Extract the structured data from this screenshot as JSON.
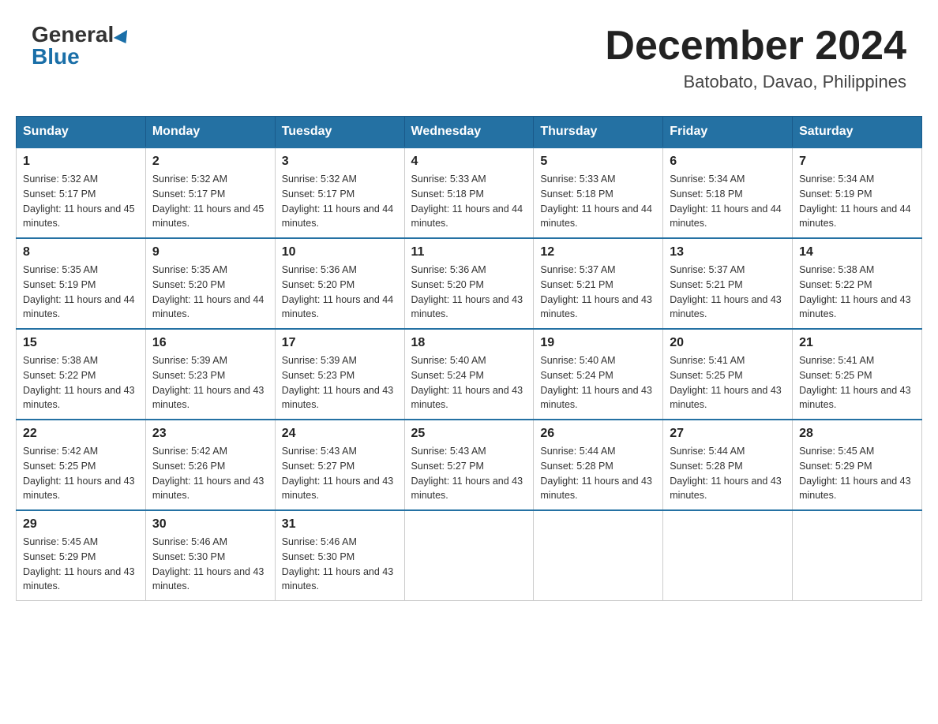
{
  "header": {
    "logo_general": "General",
    "logo_blue": "Blue",
    "month_title": "December 2024",
    "location": "Batobato, Davao, Philippines"
  },
  "days_of_week": [
    "Sunday",
    "Monday",
    "Tuesday",
    "Wednesday",
    "Thursday",
    "Friday",
    "Saturday"
  ],
  "weeks": [
    [
      {
        "day": "1",
        "sunrise": "5:32 AM",
        "sunset": "5:17 PM",
        "daylight": "11 hours and 45 minutes."
      },
      {
        "day": "2",
        "sunrise": "5:32 AM",
        "sunset": "5:17 PM",
        "daylight": "11 hours and 45 minutes."
      },
      {
        "day": "3",
        "sunrise": "5:32 AM",
        "sunset": "5:17 PM",
        "daylight": "11 hours and 44 minutes."
      },
      {
        "day": "4",
        "sunrise": "5:33 AM",
        "sunset": "5:18 PM",
        "daylight": "11 hours and 44 minutes."
      },
      {
        "day": "5",
        "sunrise": "5:33 AM",
        "sunset": "5:18 PM",
        "daylight": "11 hours and 44 minutes."
      },
      {
        "day": "6",
        "sunrise": "5:34 AM",
        "sunset": "5:18 PM",
        "daylight": "11 hours and 44 minutes."
      },
      {
        "day": "7",
        "sunrise": "5:34 AM",
        "sunset": "5:19 PM",
        "daylight": "11 hours and 44 minutes."
      }
    ],
    [
      {
        "day": "8",
        "sunrise": "5:35 AM",
        "sunset": "5:19 PM",
        "daylight": "11 hours and 44 minutes."
      },
      {
        "day": "9",
        "sunrise": "5:35 AM",
        "sunset": "5:20 PM",
        "daylight": "11 hours and 44 minutes."
      },
      {
        "day": "10",
        "sunrise": "5:36 AM",
        "sunset": "5:20 PM",
        "daylight": "11 hours and 44 minutes."
      },
      {
        "day": "11",
        "sunrise": "5:36 AM",
        "sunset": "5:20 PM",
        "daylight": "11 hours and 43 minutes."
      },
      {
        "day": "12",
        "sunrise": "5:37 AM",
        "sunset": "5:21 PM",
        "daylight": "11 hours and 43 minutes."
      },
      {
        "day": "13",
        "sunrise": "5:37 AM",
        "sunset": "5:21 PM",
        "daylight": "11 hours and 43 minutes."
      },
      {
        "day": "14",
        "sunrise": "5:38 AM",
        "sunset": "5:22 PM",
        "daylight": "11 hours and 43 minutes."
      }
    ],
    [
      {
        "day": "15",
        "sunrise": "5:38 AM",
        "sunset": "5:22 PM",
        "daylight": "11 hours and 43 minutes."
      },
      {
        "day": "16",
        "sunrise": "5:39 AM",
        "sunset": "5:23 PM",
        "daylight": "11 hours and 43 minutes."
      },
      {
        "day": "17",
        "sunrise": "5:39 AM",
        "sunset": "5:23 PM",
        "daylight": "11 hours and 43 minutes."
      },
      {
        "day": "18",
        "sunrise": "5:40 AM",
        "sunset": "5:24 PM",
        "daylight": "11 hours and 43 minutes."
      },
      {
        "day": "19",
        "sunrise": "5:40 AM",
        "sunset": "5:24 PM",
        "daylight": "11 hours and 43 minutes."
      },
      {
        "day": "20",
        "sunrise": "5:41 AM",
        "sunset": "5:25 PM",
        "daylight": "11 hours and 43 minutes."
      },
      {
        "day": "21",
        "sunrise": "5:41 AM",
        "sunset": "5:25 PM",
        "daylight": "11 hours and 43 minutes."
      }
    ],
    [
      {
        "day": "22",
        "sunrise": "5:42 AM",
        "sunset": "5:25 PM",
        "daylight": "11 hours and 43 minutes."
      },
      {
        "day": "23",
        "sunrise": "5:42 AM",
        "sunset": "5:26 PM",
        "daylight": "11 hours and 43 minutes."
      },
      {
        "day": "24",
        "sunrise": "5:43 AM",
        "sunset": "5:27 PM",
        "daylight": "11 hours and 43 minutes."
      },
      {
        "day": "25",
        "sunrise": "5:43 AM",
        "sunset": "5:27 PM",
        "daylight": "11 hours and 43 minutes."
      },
      {
        "day": "26",
        "sunrise": "5:44 AM",
        "sunset": "5:28 PM",
        "daylight": "11 hours and 43 minutes."
      },
      {
        "day": "27",
        "sunrise": "5:44 AM",
        "sunset": "5:28 PM",
        "daylight": "11 hours and 43 minutes."
      },
      {
        "day": "28",
        "sunrise": "5:45 AM",
        "sunset": "5:29 PM",
        "daylight": "11 hours and 43 minutes."
      }
    ],
    [
      {
        "day": "29",
        "sunrise": "5:45 AM",
        "sunset": "5:29 PM",
        "daylight": "11 hours and 43 minutes."
      },
      {
        "day": "30",
        "sunrise": "5:46 AM",
        "sunset": "5:30 PM",
        "daylight": "11 hours and 43 minutes."
      },
      {
        "day": "31",
        "sunrise": "5:46 AM",
        "sunset": "5:30 PM",
        "daylight": "11 hours and 43 minutes."
      },
      null,
      null,
      null,
      null
    ]
  ],
  "labels": {
    "sunrise": "Sunrise:",
    "sunset": "Sunset:",
    "daylight": "Daylight:"
  }
}
